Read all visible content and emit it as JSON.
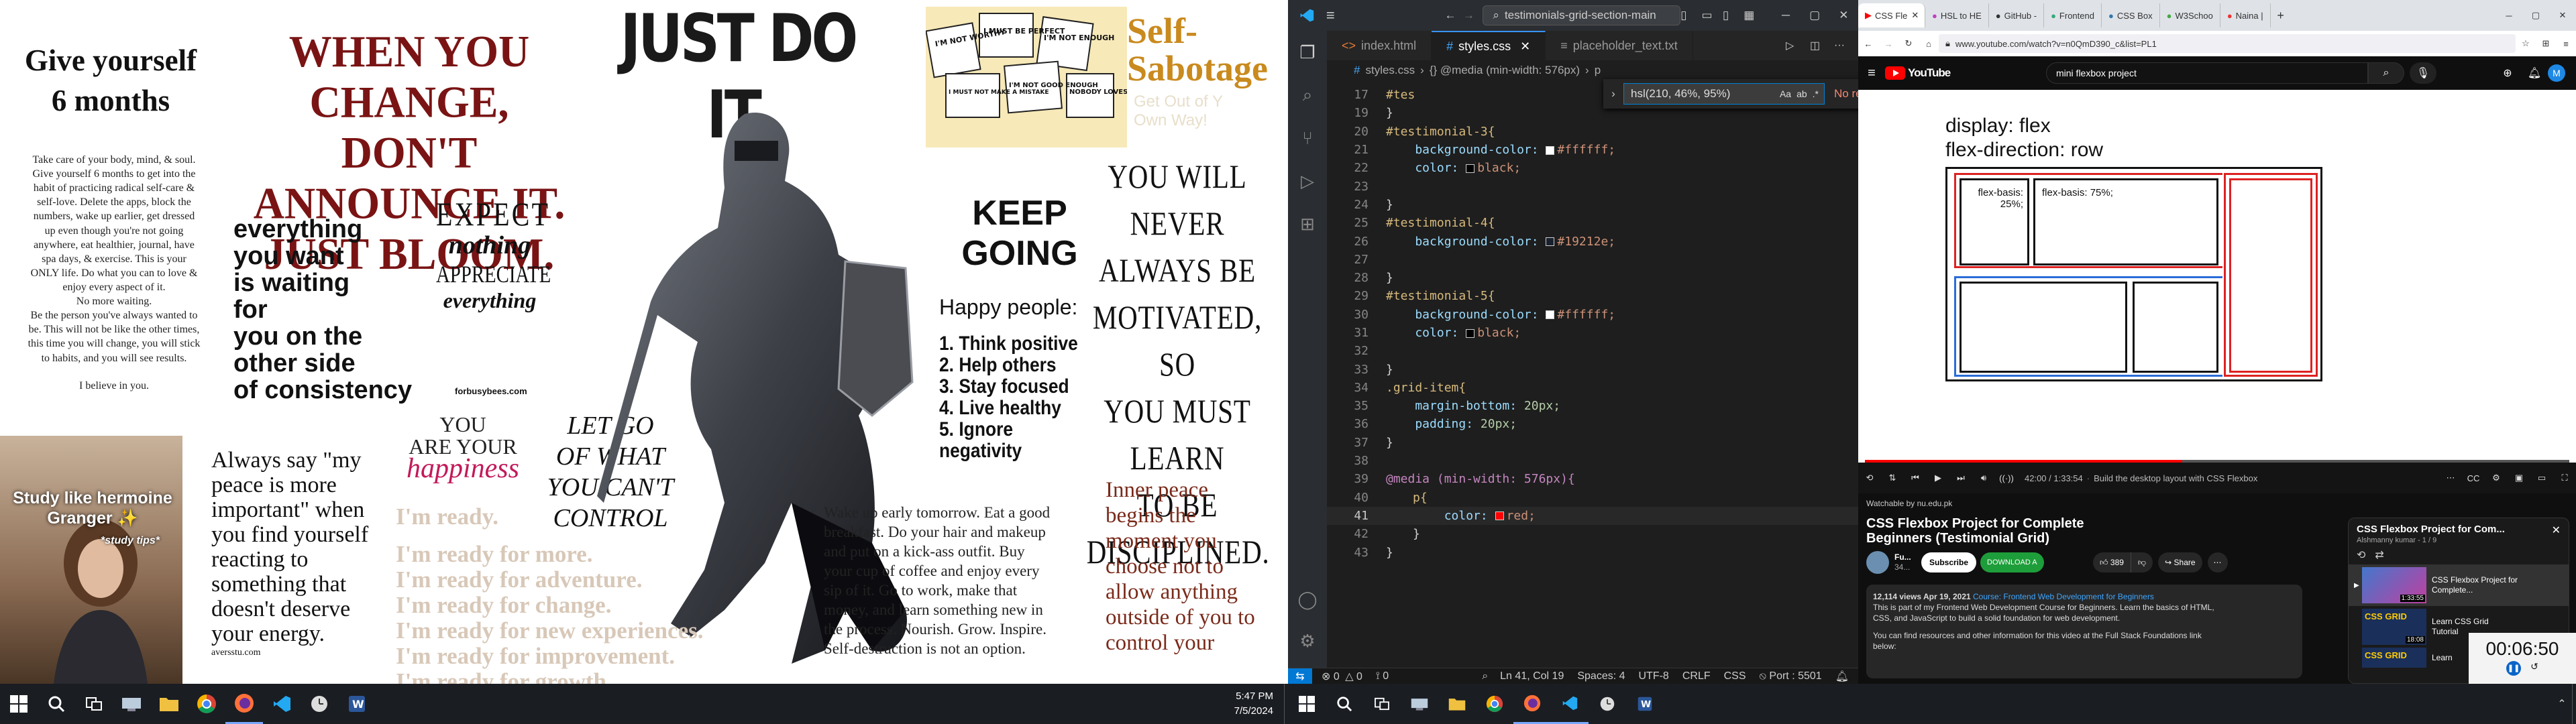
{
  "wallpaper": {
    "give_title": [
      "Give yourself",
      "6 months"
    ],
    "give_body": [
      "Take care of your body, mind, & soul.",
      "Give yourself 6 months to get into the",
      "habit of practicing radical self-care &",
      "self-love. Delete the apps, block the",
      "numbers, wake up earlier, get dressed",
      "up even though you're not going",
      "anywhere, eat healthier, journal, have",
      "spa days, & exercise. This is your",
      "ONLY life. Do what you can to love &",
      "enjoy every aspect of it.",
      "No more waiting.",
      "Be the person you've always wanted to",
      "be. This will not be like the other times,",
      "this time you will change, you will stick",
      "to habits, and you will see results."
    ],
    "give_footer": "I believe in you.",
    "change_lines": [
      "WHEN YOU CHANGE,",
      "DON'T ANNOUNCE IT.",
      "JUST BLOOM."
    ],
    "just_do_it": "JUST DO IT.",
    "self_sabotage": [
      "Self-",
      "Sabotage"
    ],
    "sabotage_faint": [
      "Get Out of Y",
      "Own Way!"
    ],
    "signs": [
      "I'M NOT WORTHY",
      "I MUST BE PERFECT",
      "I'M NOT ENOUGH",
      "I MUST NOT MAKE A MISTAKE",
      "I'M NOT GOOD ENOUGH",
      "NOBODY LOVES ME"
    ],
    "everything": [
      "everything",
      "you want",
      "is waiting",
      "for",
      "you on the",
      "other side",
      "of consistency"
    ],
    "forbusybees": "forbusybees.com",
    "expect": [
      "EXPECT",
      "nothing",
      "APPRECIATE",
      "everything"
    ],
    "you_are": [
      "YOU",
      "ARE YOUR",
      "happiness"
    ],
    "let_go": [
      "LET GO",
      "OF WHAT",
      "YOU CAN'T",
      "CONTROL"
    ],
    "keep_going": [
      "KEEP",
      "GOING"
    ],
    "happy_title": "Happy people:",
    "happy_list": [
      "1. Think positive",
      "2. Help others",
      "3. Stay focused",
      "4. Live healthy",
      "5. Ignore negativity"
    ],
    "never": [
      "YOU WILL NEVER",
      "ALWAYS BE",
      "MOTIVATED, SO",
      "YOU MUST LEARN",
      "TO BE",
      "DISCIPLINED."
    ],
    "hermione": [
      "Study like hermoine",
      "Granger ✨",
      "*study tips*"
    ],
    "peace_quote": [
      "Always say \"my",
      "peace is more",
      "important\" when",
      "you find yourself",
      "reacting to",
      "something that",
      "doesn't deserve",
      "your energy."
    ],
    "peace_src": "aversstu.com",
    "ready": [
      "I'm ready.",
      "I'm ready for more.",
      "I'm ready for adventure.",
      "I'm ready for change.",
      "I'm ready for new experiences.",
      "I'm ready for improvement.",
      "I'm ready for growth."
    ],
    "wake_up": [
      "Wake up early tomorrow. Eat a good",
      "breakfast. Do your hair and makeup",
      "and put on a kick-ass outfit. Buy",
      "your cup of coffee and enjoy every",
      "sip of it. Go to work, make that",
      "money, and learn something new in",
      "the process. Nourish. Grow. Inspire.",
      "Self-destruction is not an option."
    ],
    "inner_peace": [
      "Inner peace",
      "begins the",
      "moment you",
      "choose not to",
      "allow anything",
      "outside of you to",
      "control your"
    ]
  },
  "taskbar1": {
    "time": "5:47 PM",
    "date": "7/5/2024"
  },
  "vscode": {
    "search": "testimonials-grid-section-main",
    "tabs": [
      "index.html",
      "styles.css",
      "placeholder_text.txt"
    ],
    "breadcrumb": [
      "styles.css",
      "{} @media (min-width: 576px)",
      "p"
    ],
    "find_query": "hsl(210, 46%, 95%)",
    "find_result": "No results",
    "lines": [
      {
        "n": "17",
        "text": "#tes"
      },
      {
        "n": "19",
        "text": "}"
      },
      {
        "n": "20",
        "text": "#testimonial-3{"
      },
      {
        "n": "21",
        "prop": "background-color:",
        "swatch": "#ffffff",
        "value": "#ffffff;"
      },
      {
        "n": "22",
        "prop": "color:",
        "swatch": "#000000",
        "value": "black;"
      },
      {
        "n": "23",
        "text": ""
      },
      {
        "n": "24",
        "text": "}"
      },
      {
        "n": "25",
        "text": "#testimonial-4{"
      },
      {
        "n": "26",
        "prop": "background-color:",
        "swatch": "#19212e",
        "value": "#19212e;"
      },
      {
        "n": "27",
        "text": ""
      },
      {
        "n": "28",
        "text": "}"
      },
      {
        "n": "29",
        "text": "#testimonial-5{"
      },
      {
        "n": "30",
        "prop": "background-color:",
        "swatch": "#ffffff",
        "value": "#ffffff;"
      },
      {
        "n": "31",
        "prop": "color:",
        "swatch": "#000000",
        "value": "black;"
      },
      {
        "n": "32",
        "text": ""
      },
      {
        "n": "33",
        "text": "}"
      },
      {
        "n": "34",
        "text": ".grid-item{"
      },
      {
        "n": "35",
        "prop": "margin-bottom:",
        "value": "20px;"
      },
      {
        "n": "36",
        "prop": "padding:",
        "value": "20px;"
      },
      {
        "n": "37",
        "text": "}"
      },
      {
        "n": "38",
        "text": ""
      },
      {
        "n": "39",
        "text": "@media (min-width: 576px){"
      },
      {
        "n": "40",
        "text": "p{"
      },
      {
        "n": "41",
        "prop": "color:",
        "swatch": "#ff0000",
        "value": "red;"
      },
      {
        "n": "42",
        "text": "}"
      },
      {
        "n": "43",
        "text": "}"
      }
    ],
    "status": {
      "errors": "0",
      "warnings": "0",
      "ports": "0",
      "position": "Ln 41, Col 19",
      "spaces": "Spaces: 4",
      "encoding": "UTF-8",
      "eol": "CRLF",
      "lang": "CSS",
      "port": "Port : 5501"
    }
  },
  "browser": {
    "tabs": [
      "CSS Fle",
      "HSL to HE",
      "GitHub -",
      "Frontend",
      "CSS Box",
      "W3Schoo",
      "Naina |"
    ],
    "url": "www.youtube.com/watch?v=n0QmD390_c&list=PL1",
    "yt_search": "mini flexbox project",
    "video_lines": [
      "display: flex",
      "flex-direction: row"
    ],
    "box1": [
      "flex-basis:",
      "25%;"
    ],
    "box2": "flex-basis: 75%;",
    "time": "42:00 / 1:33:54",
    "chapter": "Build the desktop layout with CSS Flexbox",
    "watchable": "Watchable by nu.edu.pk",
    "title": "CSS Flexbox Project for Complete Beginners (Testimonial Grid)",
    "channel": "Fu...",
    "subs": "34...",
    "subscribe": "Subscribe",
    "download": "DOWNLOAD A",
    "likes": "389",
    "share": "Share",
    "views": "12,114 views  Apr 19, 2021",
    "course": "Course: Frontend Web Development for Beginners",
    "desc1": "This is part of my Frontend Web Development Course for Beginners. Learn the basics of HTML,",
    "desc2": "CSS, and JavaScript to build a solid foundation for web development.",
    "desc3": "You can find resources and other information for this video at the Full Stack Foundations link",
    "desc4": "below:",
    "playlist_title": "CSS Flexbox Project for Com...",
    "playlist_sub": "Alshmanny kumar - 1 / 9",
    "pl1": "CSS Flexbox Project for Complete...",
    "pl2": "Learn CSS Grid Tutorial",
    "pl3": "Learn",
    "pl_badge": "1:33:55",
    "pl_badge2": "18:08",
    "timer": "00:06:50"
  }
}
